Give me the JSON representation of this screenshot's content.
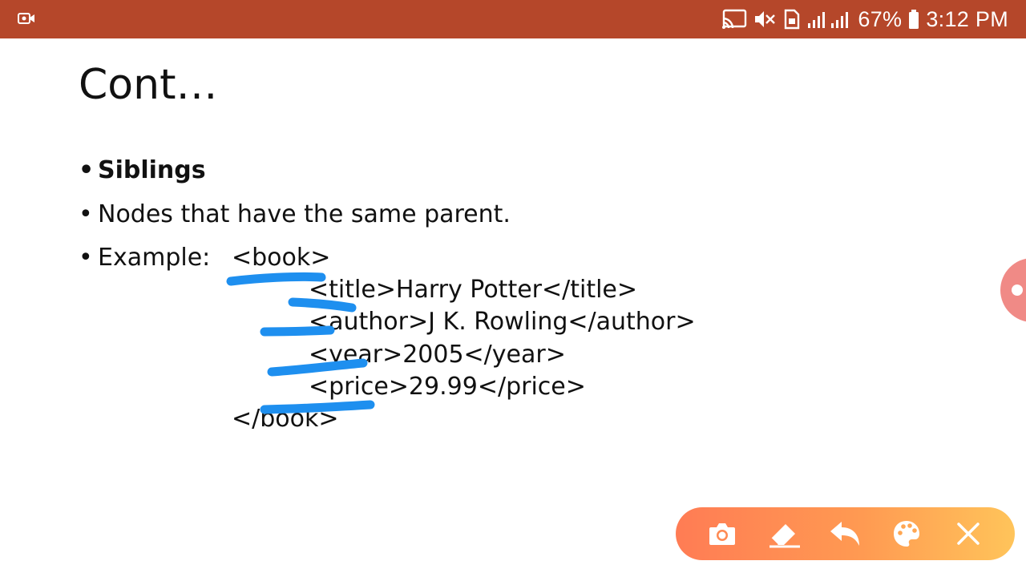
{
  "status_bar": {
    "battery": "67%",
    "time": "3:12 PM",
    "background_color": "#b5472a"
  },
  "slide": {
    "title": "Cont…",
    "bullets": [
      {
        "dot": "•",
        "text": "Siblings"
      },
      {
        "dot": "•",
        "text": "Nodes that have the same parent."
      },
      {
        "dot": "•",
        "text": "Example:"
      }
    ],
    "code_lines": [
      "<book>",
      "<title>Harry Potter</title>",
      "<author>J K. Rowling</author>",
      "<year>2005</year>",
      "<price>29.99</price>",
      "</book>"
    ]
  },
  "annotation": {
    "ink_color": "#1e8fef"
  },
  "toolbar": {
    "tools": [
      "camera-icon",
      "eraser-icon",
      "undo-icon",
      "palette-icon",
      "close-icon"
    ],
    "gradient_start": "#ff7c54",
    "gradient_end": "#ffc45a"
  },
  "side_handle": {
    "color": "#f08a86"
  }
}
